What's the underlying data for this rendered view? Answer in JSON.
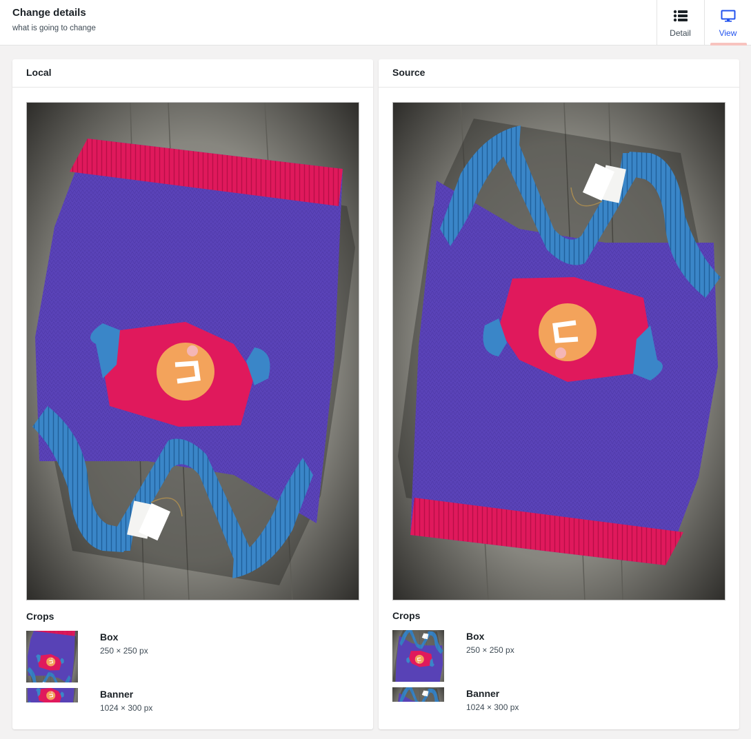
{
  "header": {
    "title": "Change details",
    "subtitle": "what is going to change"
  },
  "tabs": [
    {
      "label": "Detail",
      "icon": "list-icon",
      "active": false
    },
    {
      "label": "View",
      "icon": "monitor-icon",
      "active": true
    }
  ],
  "colors": {
    "accent": "#2152ee",
    "active_tab_underline": "#f8c3bf",
    "sweater_body": "#5a43b8",
    "ribbing_blue": "#3a86c8",
    "ribbing_pink": "#e0195c",
    "motif_orange": "#f3a35b",
    "floor": "#8a8980"
  },
  "panels": {
    "local": {
      "title": "Local",
      "crops_title": "Crops",
      "crops": [
        {
          "name": "Box",
          "size": "250 × 250 px"
        },
        {
          "name": "Banner",
          "size": "1024 × 300 px"
        }
      ]
    },
    "source": {
      "title": "Source",
      "crops_title": "Crops",
      "crops": [
        {
          "name": "Box",
          "size": "250 × 250 px"
        },
        {
          "name": "Banner",
          "size": "1024 × 300 px"
        }
      ]
    }
  }
}
